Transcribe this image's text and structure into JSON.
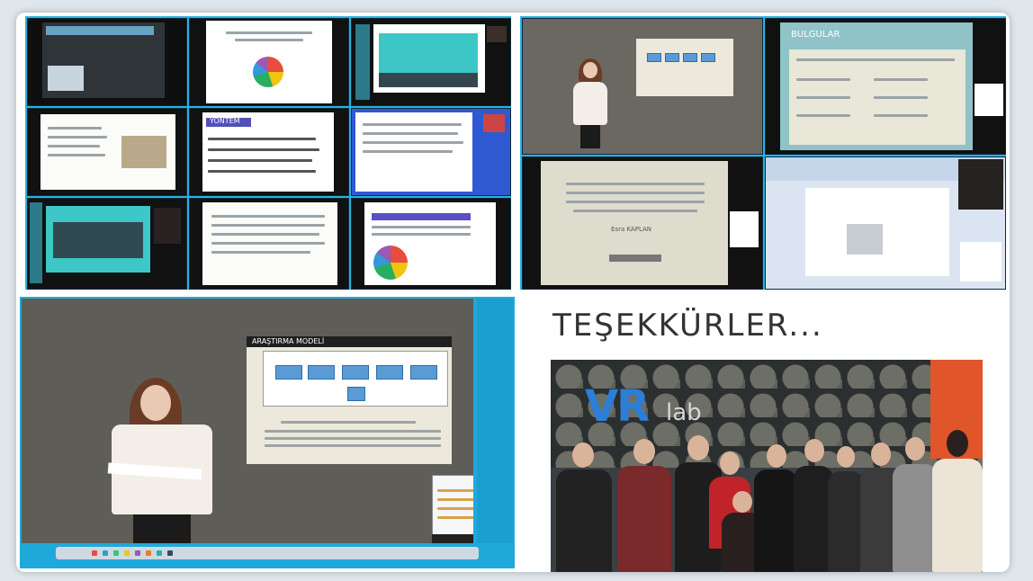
{
  "thanks": {
    "title": "TEŞEKKÜRLER..."
  },
  "photo": {
    "logo_vr": "VR",
    "logo_lab": "lab"
  },
  "tiles": {
    "results_title": "BULGULAR",
    "method_title": "YÖNTEM",
    "flow_title": "ARAŞTIRMA MODELİ",
    "author": "Esra KAPLAN"
  },
  "colors": {
    "accent_blue": "#2ab2e0",
    "teal": "#3dc7c6",
    "card_bg": "#ffffff"
  }
}
